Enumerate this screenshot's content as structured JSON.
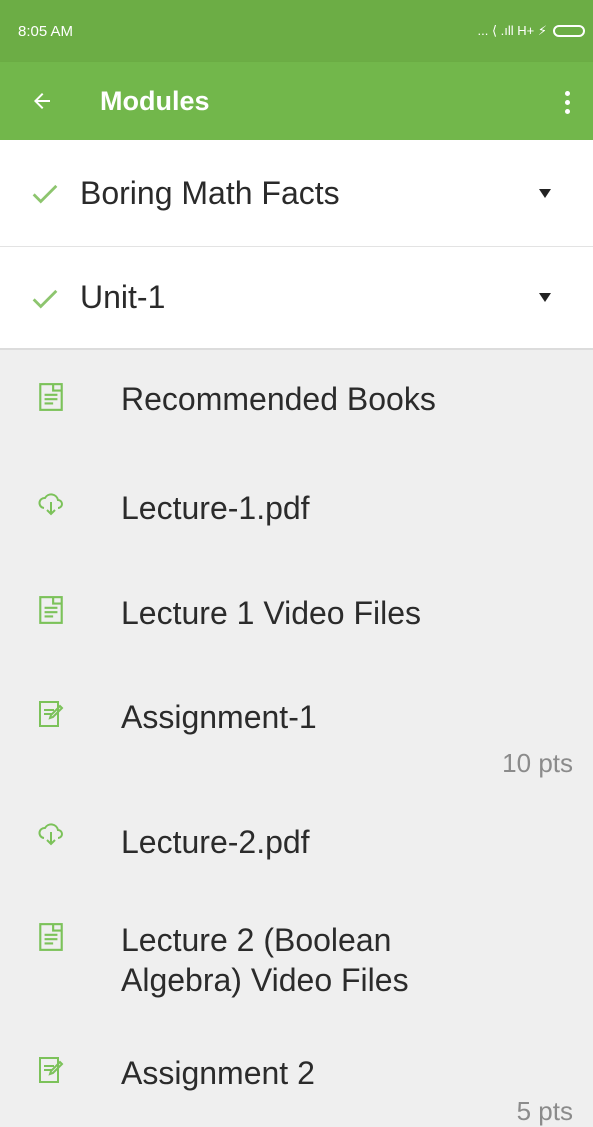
{
  "status_bar": {
    "time": "8:05 AM",
    "network": "... ⟨ .ıll H+ ⚡"
  },
  "app_bar": {
    "title": "Modules"
  },
  "sections": [
    {
      "title": "Boring Math Facts"
    },
    {
      "title": "Unit-1"
    }
  ],
  "items": [
    {
      "label": "Recommended Books",
      "icon": "page-icon"
    },
    {
      "label": "Lecture-1.pdf",
      "icon": "cloud-download-icon"
    },
    {
      "label": "Lecture 1 Video Files",
      "icon": "page-icon"
    },
    {
      "label": "Assignment-1",
      "icon": "assignment-icon",
      "points": "10 pts"
    },
    {
      "label": "Lecture-2.pdf",
      "icon": "cloud-download-icon"
    },
    {
      "label": "Lecture 2 (Boolean",
      "label_line2": "Algebra) Video Files",
      "icon": "page-icon"
    },
    {
      "label": "Assignment 2",
      "icon": "assignment-icon",
      "points": "5 pts"
    }
  ],
  "colors": {
    "accent": "#72b74b",
    "status": "#6cad45",
    "icon": "#7cc25a"
  }
}
